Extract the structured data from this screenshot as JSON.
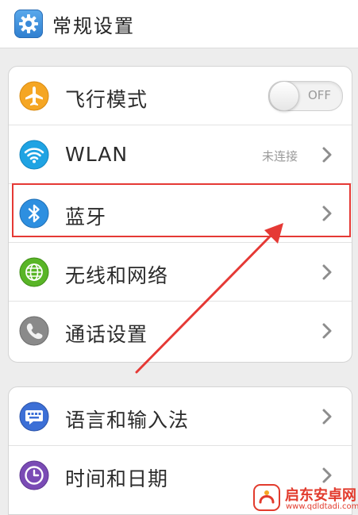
{
  "header": {
    "title": "常规设置",
    "icon": "gear-icon"
  },
  "group1": [
    {
      "label": "飞行模式",
      "icon": "airplane-icon",
      "control": "toggle",
      "toggle_text": "OFF",
      "toggle_on": false
    },
    {
      "label": "WLAN",
      "icon": "wifi-icon",
      "status": "未连接",
      "control": "chevron"
    },
    {
      "label": "蓝牙",
      "icon": "bluetooth-icon",
      "control": "chevron",
      "highlighted": true
    },
    {
      "label": "无线和网络",
      "icon": "globe-icon",
      "control": "chevron"
    },
    {
      "label": "通话设置",
      "icon": "phone-icon",
      "control": "chevron"
    }
  ],
  "group2": [
    {
      "label": "语言和输入法",
      "icon": "keyboard-icon",
      "control": "chevron"
    },
    {
      "label": "时间和日期",
      "icon": "clock-icon",
      "control": "chevron"
    }
  ],
  "watermark": {
    "title": "启东安卓网",
    "url": "www.qdldtadi.com"
  },
  "colors": {
    "highlight": "#e53935",
    "airplane": "#f5a623",
    "wifi": "#1fa3e3",
    "bluetooth": "#2d8fe0",
    "globe": "#59b527",
    "phone": "#8a8a8a",
    "keyboard": "#3c6fd6",
    "clock": "#7a4bb5"
  }
}
